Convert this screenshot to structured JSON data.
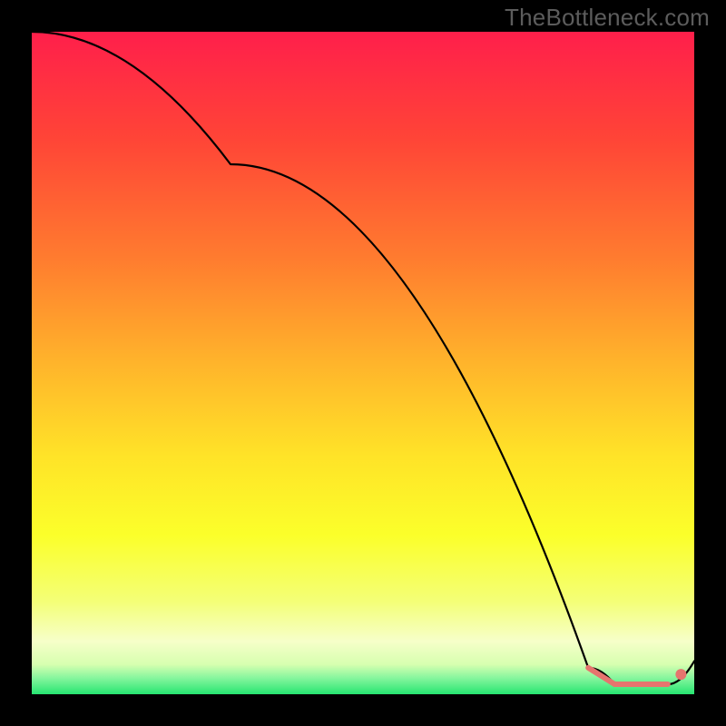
{
  "watermark": "TheBottleneck.com",
  "chart_data": {
    "type": "line",
    "title": "",
    "xlabel": "",
    "ylabel": "",
    "xlim": [
      0,
      100
    ],
    "ylim": [
      0,
      100
    ],
    "series": [
      {
        "name": "curve",
        "color": "#000000",
        "x": [
          0,
          30,
          84,
          88,
          96,
          100
        ],
        "y": [
          100,
          80,
          4,
          1.5,
          1.5,
          5
        ]
      }
    ],
    "markers": [
      {
        "name": "threshold-band",
        "color": "#e6746e",
        "stroke_width": 6,
        "x": [
          84,
          88,
          96
        ],
        "y": [
          4,
          1.5,
          1.5
        ]
      },
      {
        "name": "end-dot",
        "color": "#e6746e",
        "radius": 6,
        "x": [
          98
        ],
        "y": [
          3
        ]
      }
    ],
    "background_gradient_stops": [
      {
        "offset": 0.0,
        "color": "#ff1f4b"
      },
      {
        "offset": 0.16,
        "color": "#ff4437"
      },
      {
        "offset": 0.34,
        "color": "#ff7b2f"
      },
      {
        "offset": 0.5,
        "color": "#ffb42b"
      },
      {
        "offset": 0.64,
        "color": "#ffe328"
      },
      {
        "offset": 0.76,
        "color": "#fbff2a"
      },
      {
        "offset": 0.86,
        "color": "#f4ff77"
      },
      {
        "offset": 0.92,
        "color": "#f6ffc9"
      },
      {
        "offset": 0.955,
        "color": "#d7ffb0"
      },
      {
        "offset": 0.975,
        "color": "#88f69e"
      },
      {
        "offset": 1.0,
        "color": "#26e571"
      }
    ]
  }
}
